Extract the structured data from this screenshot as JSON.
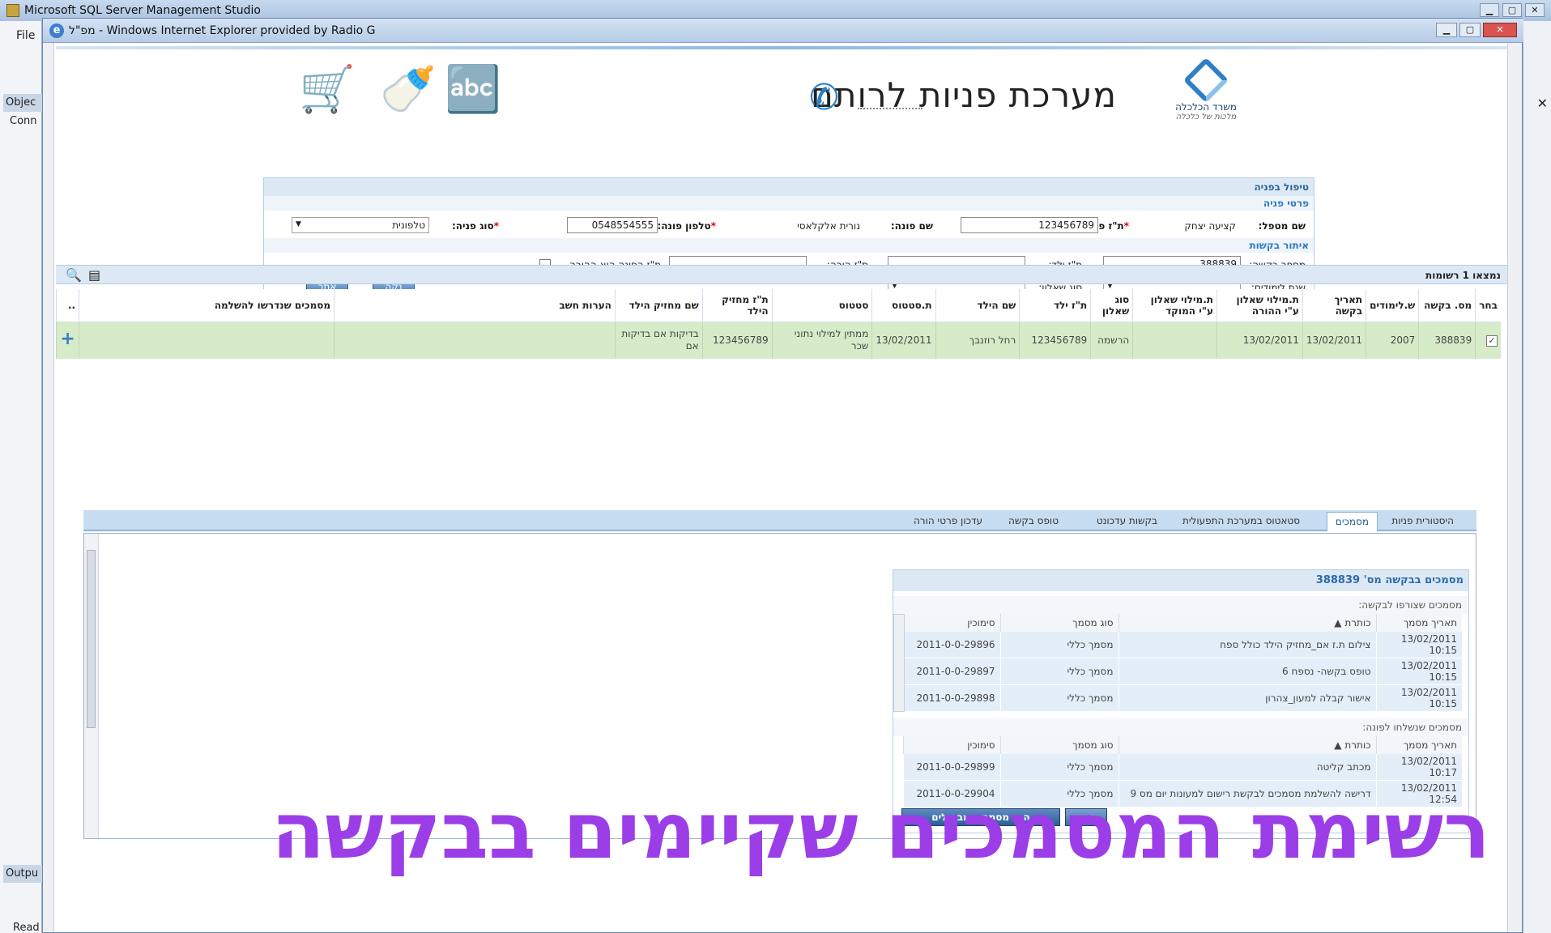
{
  "ssms": {
    "title": "Microsoft SQL Server Management Studio",
    "menu_file": "File",
    "object_explorer": "Objec",
    "connect": "Conn",
    "output": "Outpu",
    "status": "Read"
  },
  "ie": {
    "title": "מפ\"ל - Windows Internet Explorer provided by Radio G"
  },
  "header": {
    "ministry_line1": "משרד הכלכלה",
    "ministry_line2": "מלכות של כלכלה",
    "system_logo": "מערכת פניות לרותם"
  },
  "request_panel": {
    "title": "טיפול בפניה",
    "section_details": "פרטי פניה",
    "handler_label": "שם מטפל:",
    "handler_value": "קציעה יצחק",
    "applicant_id_label": "ת\"ז פונה:",
    "applicant_id_value": "123456789",
    "applicant_name_label": "שם פונה:",
    "applicant_name_value": "נורית אלקלאסי",
    "applicant_phone_label": "טלפון פונה:",
    "applicant_phone_value": "0548554555",
    "request_type_label": "סוג פניה:",
    "request_type_value": "טלפונית",
    "section_search": "איתור בקשות",
    "request_no_label": "מספר בקשה:",
    "request_no_value": "388839",
    "child_id_label": "ת\"ז ילד:",
    "child_id_value": "",
    "parent_id_label": "ת\"ז הורה:",
    "parent_id_value": "",
    "applicant_is_parent_label": "ת\"ז הפונה הוא ההורה",
    "school_year_label": "שנת לימודים:",
    "school_year_value": "",
    "questionnaire_type_label": "סוג שאלון:",
    "questionnaire_type_value": "",
    "clear_button": "נקה",
    "find_button": "אתר"
  },
  "results": {
    "count_text": "נמצאו 1 רשומות",
    "columns": [
      "בחר",
      "מס. בקשה",
      "ש.לימודים",
      "תאריך בקשה",
      "ת.מילוי שאלון ע\"י ההורה",
      "ת.מילוי שאלון ע\"י המוקד",
      "סוג שאלון",
      "ת\"ז ילד",
      "שם הילד",
      "ת.סטטוס",
      "סטטוס",
      "ת\"ז מחזיק הילד",
      "שם מחזיק הילד",
      "הערות חשב",
      "מסמכים שנדרשו להשלמה",
      ".."
    ],
    "rows": [
      {
        "selected": "✓",
        "request_no": "388839",
        "school_year": "2007",
        "request_date": "13/02/2011",
        "parent_fill_date": "13/02/2011",
        "center_fill_date": "",
        "questionnaire_type": "הרשמה",
        "child_id": "123456789",
        "child_name": "רחל רוזנבך",
        "status_date": "13/02/2011",
        "status": "ממתין למילוי נתוני שכר",
        "holder_id": "123456789",
        "holder_name": "בדיקות אם בדיקות אם",
        "accountant_notes": "",
        "missing_docs": "",
        "expand": "+"
      }
    ]
  },
  "tabs": [
    {
      "label": "היסטורית פניות",
      "active": false
    },
    {
      "label": "מסמכים",
      "active": true
    },
    {
      "label": "סטאטוס במערכת התפעולית",
      "active": false
    },
    {
      "label": "בקשות עדכונט",
      "active": false
    },
    {
      "label": "טופס בקשה",
      "active": false
    },
    {
      "label": "עדכון פרטי הורה",
      "active": false
    }
  ],
  "documents": {
    "title": "מסמכים בבקשה מס' 388839",
    "attached_title": "מסמכים שצורפו לבקשה:",
    "sent_title": "מסמכים שנשלחו לפונה:",
    "columns": [
      "תאריך מסמך",
      "כותרת",
      "סוג מסמך",
      "סימוכין"
    ],
    "attached": [
      {
        "date": "13/02/2011 10:15",
        "title": "צילום ת.ז אם_מחזיק הילד כולל ספח",
        "type": "מסמך כללי",
        "ref": "2011-0-0-29896"
      },
      {
        "date": "13/02/2011 10:15",
        "title": "טופס בקשה- נספח 6",
        "type": "מסמך כללי",
        "ref": "2011-0-0-29897"
      },
      {
        "date": "13/02/2011 10:15",
        "title": "אישור קבלה למעון_צהרון",
        "type": "מסמך כללי",
        "ref": "2011-0-0-29898"
      }
    ],
    "sent": [
      {
        "date": "13/02/2011 10:17",
        "title": "מכתב קליטה",
        "type": "מסמך כללי",
        "ref": "2011-0-0-29899"
      },
      {
        "date": "13/02/2011 12:54",
        "title": "דרישה להשלמת מסמכים לבקשת רישום למעונות יום מס 9",
        "type": "מסמך כללי",
        "ref": "2011-0-0-29904"
      }
    ],
    "show_cancelled_button": "הצג מסמכים מבוטלים",
    "refresh_button": "רענן"
  },
  "overlay_caption": "רשימת המסמכים שקיימים בבקשה",
  "colors": {
    "accent": "#2c6aab",
    "row_highlight": "#d6ecc8",
    "caption": "#9b3ee8"
  }
}
